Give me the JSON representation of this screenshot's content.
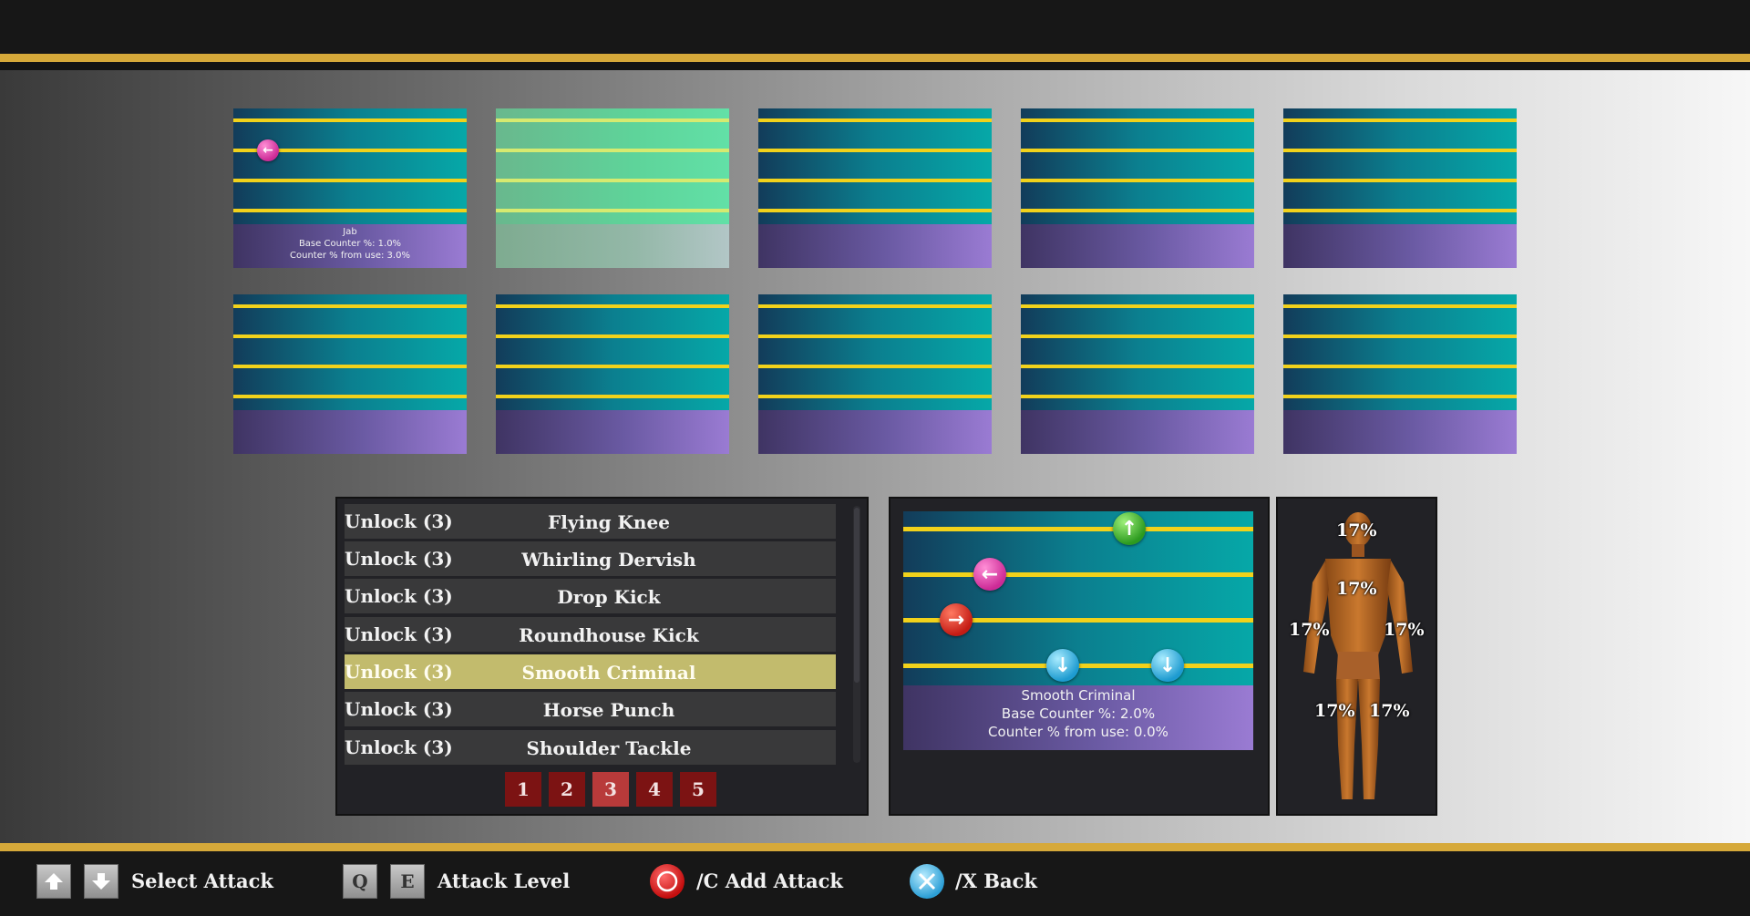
{
  "slots": [
    {
      "info_name": "Jab",
      "info_base": "Base Counter %: 1.0%",
      "info_use": "Counter % from use: 3.0%"
    },
    {
      "info_name": "",
      "info_base": "",
      "info_use": ""
    },
    {
      "info_name": "",
      "info_base": "",
      "info_use": ""
    },
    {
      "info_name": "",
      "info_base": "",
      "info_use": ""
    },
    {
      "info_name": "",
      "info_base": "",
      "info_use": ""
    },
    {
      "info_name": "",
      "info_base": "",
      "info_use": ""
    },
    {
      "info_name": "",
      "info_base": "",
      "info_use": ""
    },
    {
      "info_name": "",
      "info_base": "",
      "info_use": ""
    },
    {
      "info_name": "",
      "info_base": "",
      "info_use": ""
    },
    {
      "info_name": "",
      "info_base": "",
      "info_use": ""
    }
  ],
  "attack_list": {
    "rows": [
      {
        "unlock": "Unlock (3)",
        "name": "Flying Knee"
      },
      {
        "unlock": "Unlock (3)",
        "name": "Whirling Dervish"
      },
      {
        "unlock": "Unlock (3)",
        "name": "Drop Kick"
      },
      {
        "unlock": "Unlock (3)",
        "name": "Roundhouse Kick"
      },
      {
        "unlock": "Unlock (3)",
        "name": "Smooth Criminal"
      },
      {
        "unlock": "Unlock (3)",
        "name": "Horse Punch"
      },
      {
        "unlock": "Unlock (3)",
        "name": "Shoulder Tackle"
      }
    ],
    "selected_index": 4,
    "pages": [
      "1",
      "2",
      "3",
      "4",
      "5"
    ],
    "current_page": "3"
  },
  "preview": {
    "name": "Smooth Criminal",
    "base": "Base Counter %: 2.0%",
    "use": "Counter % from use: 0.0%"
  },
  "body_map": {
    "head": "17%",
    "torso": "17%",
    "left_arm": "17%",
    "right_arm": "17%",
    "left_leg": "17%",
    "right_leg": "17%"
  },
  "controls": {
    "select_attack": "Select Attack",
    "attack_level": "Attack Level",
    "key_q": "Q",
    "key_e": "E",
    "add_attack": "/C Add Attack",
    "back": "/X Back"
  },
  "colors": {
    "gold_trim": "#d6a93a",
    "track_line": "#f1d21b",
    "selected_row": "#c2bb6d",
    "page_button": "#7c1313",
    "page_button_active": "#b83a3a"
  }
}
